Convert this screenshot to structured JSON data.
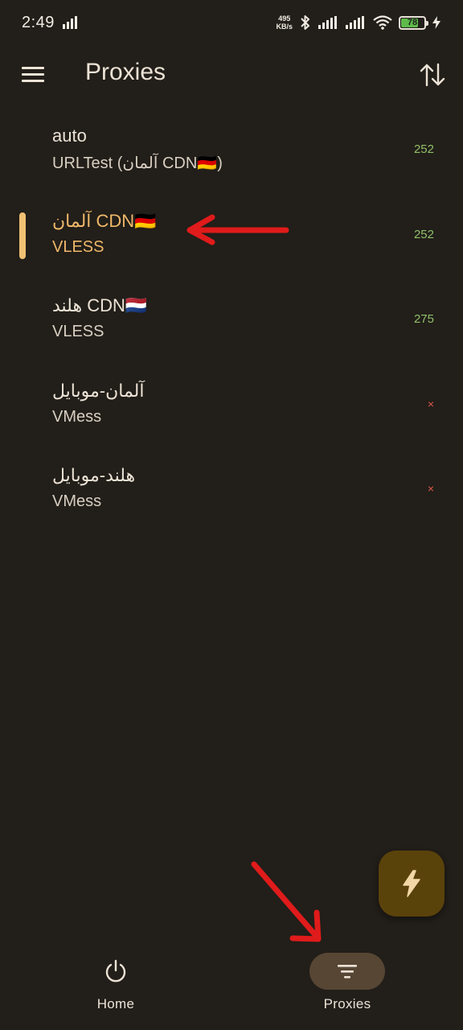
{
  "status_bar": {
    "time": "2:49",
    "net_speed_value": "495",
    "net_speed_unit": "KB/s",
    "battery_percent": "78",
    "battery_level": 0.78,
    "battery_color": "#5dbb4a"
  },
  "app_bar": {
    "title": "Proxies",
    "menu_icon": "menu-icon",
    "sort_icon": "sort-icon"
  },
  "proxies": [
    {
      "name": "auto",
      "type": "URLTest (آلمان CDN🇩🇪)",
      "delay": "252",
      "selected": false
    },
    {
      "name": "آلمان CDN🇩🇪",
      "type": "VLESS",
      "delay": "252",
      "selected": true
    },
    {
      "name": "هلند CDN🇳🇱",
      "type": "VLESS",
      "delay": "275",
      "selected": false
    },
    {
      "name": "آلمان-موبایل",
      "type": "VMess",
      "delay": "×",
      "selected": false
    },
    {
      "name": "هلند-موبایل",
      "type": "VMess",
      "delay": "×",
      "selected": false
    }
  ],
  "fab": {
    "icon": "lightning-icon"
  },
  "bottom_nav": {
    "items": [
      {
        "label": "Home",
        "icon": "power-icon",
        "active": false
      },
      {
        "label": "Proxies",
        "icon": "filter-icon",
        "active": true
      }
    ]
  },
  "colors": {
    "background": "#221e19",
    "accent": "#f0b86a",
    "delay_ok": "#8fc06a",
    "delay_fail": "#e0574d",
    "annotation_arrow": "#e01b1b"
  }
}
